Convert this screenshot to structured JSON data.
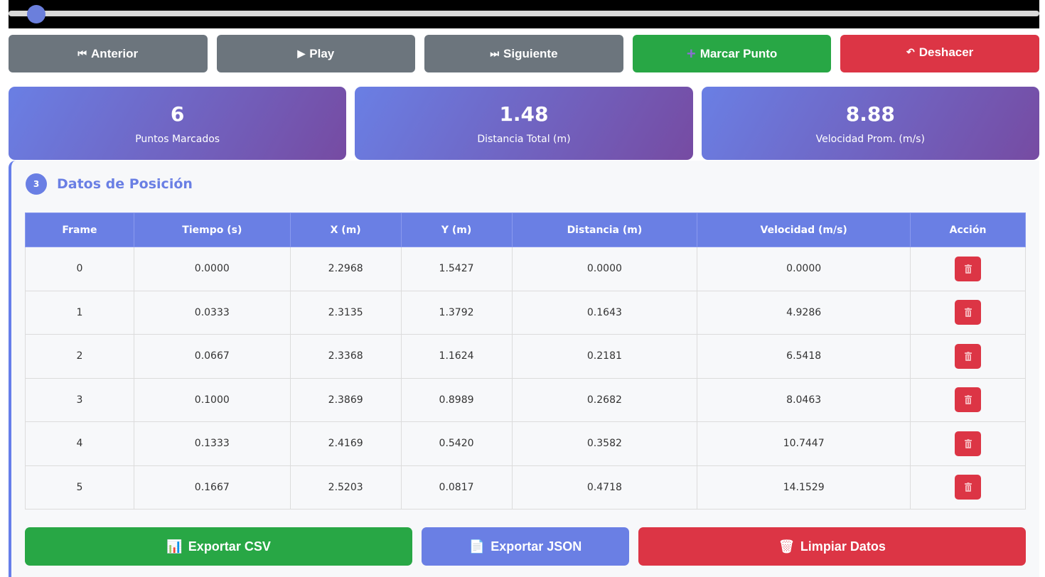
{
  "playback": {
    "progress": 0.0
  },
  "controls": {
    "prev": {
      "icon": "⏮",
      "label": "Anterior"
    },
    "play": {
      "icon": "▶",
      "label": "Play"
    },
    "next": {
      "icon": "⏭",
      "label": "Siguiente"
    },
    "mark": {
      "icon": "+",
      "label": "Marcar Punto"
    },
    "undo": {
      "icon": "↶",
      "label": "Deshacer"
    }
  },
  "stats": [
    {
      "value": "6",
      "label": "Puntos Marcados"
    },
    {
      "value": "1.48",
      "label": "Distancia Total (m)"
    },
    {
      "value": "8.88",
      "label": "Velocidad Prom. (m/s)"
    }
  ],
  "section": {
    "step": "3",
    "title": "Datos de Posición"
  },
  "table": {
    "headers": [
      "Frame",
      "Tiempo (s)",
      "X (m)",
      "Y (m)",
      "Distancia (m)",
      "Velocidad (m/s)",
      "Acción"
    ],
    "rows": [
      [
        "0",
        "0.0000",
        "2.2968",
        "1.5427",
        "0.0000",
        "0.0000"
      ],
      [
        "1",
        "0.0333",
        "2.3135",
        "1.3792",
        "0.1643",
        "4.9286"
      ],
      [
        "2",
        "0.0667",
        "2.3368",
        "1.1624",
        "0.2181",
        "6.5418"
      ],
      [
        "3",
        "0.1000",
        "2.3869",
        "0.8989",
        "0.2682",
        "8.0463"
      ],
      [
        "4",
        "0.1333",
        "2.4169",
        "0.5420",
        "0.3582",
        "10.7447"
      ],
      [
        "5",
        "0.1667",
        "2.5203",
        "0.0817",
        "0.4718",
        "14.1529"
      ]
    ],
    "delete_icon": "trash-icon"
  },
  "actions": {
    "csv": {
      "icon": "📊",
      "label": "Exportar CSV"
    },
    "json": {
      "icon": "📄",
      "label": "Exportar JSON"
    },
    "clear": {
      "icon": "🗑",
      "label": "Limpiar Datos"
    }
  },
  "colors": {
    "primary": "#667eea",
    "secondary_gradient_end": "#764ba2",
    "success": "#28a745",
    "danger": "#dc3545",
    "neutral": "#6c757d"
  }
}
